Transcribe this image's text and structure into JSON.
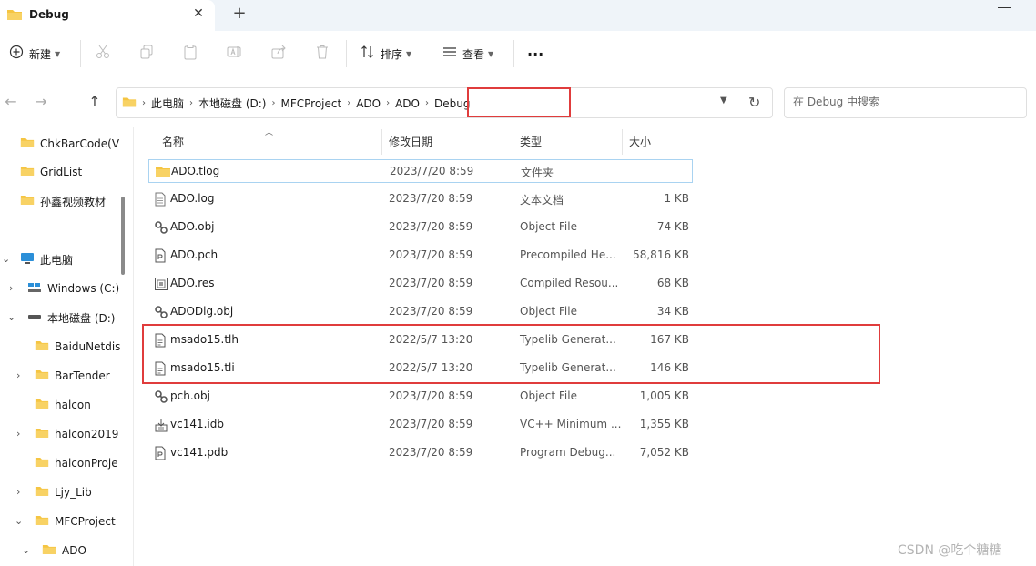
{
  "tab": {
    "title": "Debug",
    "close_glyph": "✕",
    "new_tab_glyph": "+"
  },
  "toolbar": {
    "new_label": "新建",
    "sort_label": "排序",
    "view_label": "查看",
    "more_glyph": "···"
  },
  "nav": {
    "back": "←",
    "forward": "→",
    "up": "↑"
  },
  "address": {
    "crumbs": [
      "此电脑",
      "本地磁盘 (D:)",
      "MFCProject",
      "ADO",
      "ADO",
      "Debug"
    ]
  },
  "search": {
    "placeholder": "在 Debug 中搜索"
  },
  "sidebar": {
    "items": [
      {
        "label": "ChkBarCode(V",
        "icon": "folder-icon"
      },
      {
        "label": "GridList",
        "icon": "folder-icon"
      },
      {
        "label": "孙鑫视频教材",
        "icon": "folder-icon"
      },
      {
        "label": "此电脑",
        "icon": "computer-icon"
      },
      {
        "label": "Windows (C:)",
        "icon": "windows-drive-icon"
      },
      {
        "label": "本地磁盘 (D:)",
        "icon": "drive-icon"
      },
      {
        "label": "BaiduNetdis",
        "icon": "folder-icon"
      },
      {
        "label": "BarTender",
        "icon": "folder-icon"
      },
      {
        "label": "halcon",
        "icon": "folder-icon"
      },
      {
        "label": "halcon2019",
        "icon": "folder-icon"
      },
      {
        "label": "halconProje",
        "icon": "folder-icon"
      },
      {
        "label": "Ljy_Lib",
        "icon": "folder-icon"
      },
      {
        "label": "MFCProject",
        "icon": "folder-icon"
      },
      {
        "label": "ADO",
        "icon": "folder-icon"
      }
    ]
  },
  "columns": {
    "name": "名称",
    "date": "修改日期",
    "type": "类型",
    "size": "大小"
  },
  "files": [
    {
      "name": "ADO.tlog",
      "date": "2023/7/20 8:59",
      "type": "文件夹",
      "size": "",
      "icon": "folder-icon"
    },
    {
      "name": "ADO.log",
      "date": "2023/7/20 8:59",
      "type": "文本文档",
      "size": "1 KB",
      "icon": "text-file-icon"
    },
    {
      "name": "ADO.obj",
      "date": "2023/7/20 8:59",
      "type": "Object File",
      "size": "74 KB",
      "icon": "object-file-icon"
    },
    {
      "name": "ADO.pch",
      "date": "2023/7/20 8:59",
      "type": "Precompiled He...",
      "size": "58,816 KB",
      "icon": "pch-file-icon"
    },
    {
      "name": "ADO.res",
      "date": "2023/7/20 8:59",
      "type": "Compiled Resou...",
      "size": "68 KB",
      "icon": "resource-file-icon"
    },
    {
      "name": "ADODlg.obj",
      "date": "2023/7/20 8:59",
      "type": "Object File",
      "size": "34 KB",
      "icon": "object-file-icon"
    },
    {
      "name": "msado15.tlh",
      "date": "2022/5/7 13:20",
      "type": "Typelib Generat...",
      "size": "167 KB",
      "icon": "typelib-file-icon"
    },
    {
      "name": "msado15.tli",
      "date": "2022/5/7 13:20",
      "type": "Typelib Generat...",
      "size": "146 KB",
      "icon": "typelib-file-icon"
    },
    {
      "name": "pch.obj",
      "date": "2023/7/20 8:59",
      "type": "Object File",
      "size": "1,005 KB",
      "icon": "object-file-icon"
    },
    {
      "name": "vc141.idb",
      "date": "2023/7/20 8:59",
      "type": "VC++ Minimum ...",
      "size": "1,355 KB",
      "icon": "idb-file-icon"
    },
    {
      "name": "vc141.pdb",
      "date": "2023/7/20 8:59",
      "type": "Program Debug...",
      "size": "7,052 KB",
      "icon": "pdb-file-icon"
    }
  ],
  "watermark": "CSDN @吃个糖糖",
  "colors": {
    "folder": "#f5c542",
    "highlight": "#e03c3c",
    "selection_border": "#a9d3f1"
  }
}
